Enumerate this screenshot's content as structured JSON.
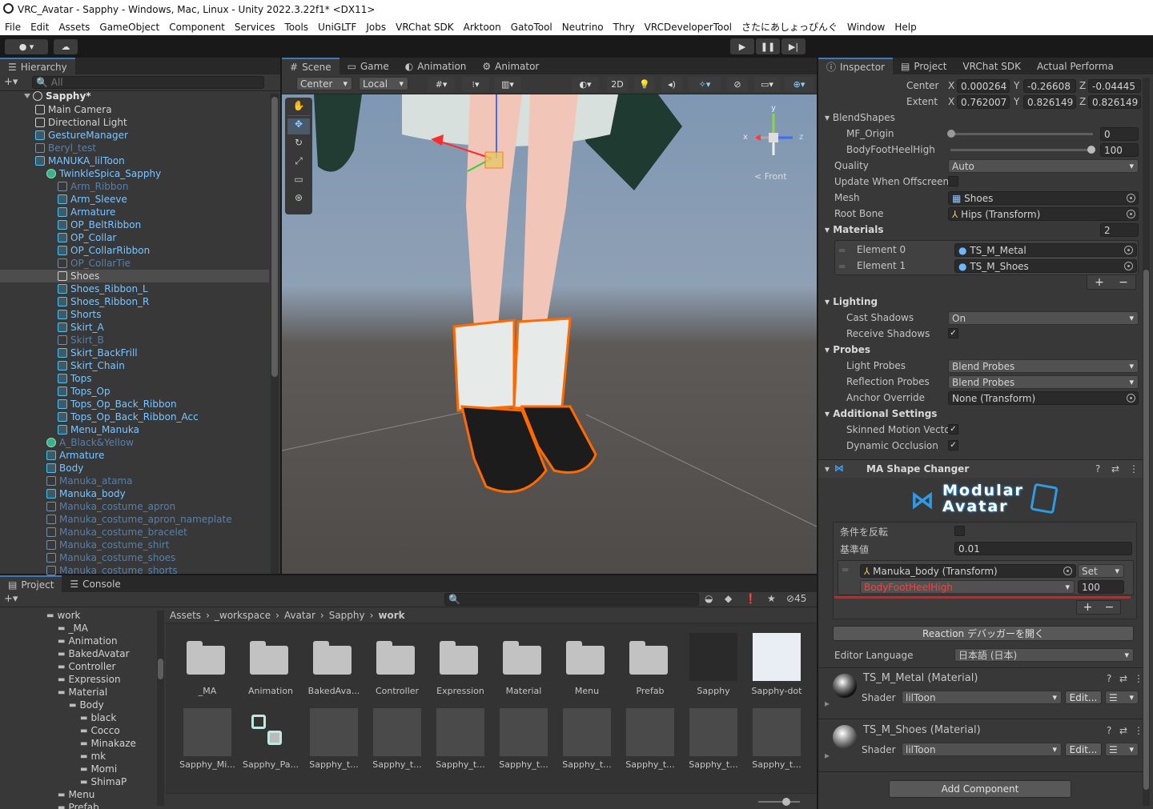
{
  "window_title": "VRC_Avatar - Sapphy - Windows, Mac, Linux - Unity 2022.3.22f1* <DX11>",
  "menu": [
    "File",
    "Edit",
    "Assets",
    "GameObject",
    "Component",
    "Services",
    "Tools",
    "UniGLTF",
    "Jobs",
    "VRChat SDK",
    "Arktoon",
    "GatoTool",
    "Neutrino",
    "Thry",
    "VRCDeveloperTool",
    "さたにあしょっぴんぐ",
    "Window",
    "Help"
  ],
  "hierarchy": {
    "tab": "Hierarchy",
    "search_placeholder": "All",
    "scene": "Sapphy*",
    "rows": [
      {
        "t": "Main Camera",
        "i": 1,
        "c": "n"
      },
      {
        "t": "Directional Light",
        "i": 1,
        "c": "n"
      },
      {
        "t": "GestureManager",
        "i": 1,
        "c": "b"
      },
      {
        "t": "Beryl_test",
        "i": 1,
        "c": "d"
      },
      {
        "t": "MANUKA_lilToon",
        "i": 1,
        "c": "b"
      },
      {
        "t": "TwinkleSpica_Sapphy",
        "i": 2,
        "c": "b"
      },
      {
        "t": "Arm_Ribbon",
        "i": 3,
        "c": "d"
      },
      {
        "t": "Arm_Sleeve",
        "i": 3,
        "c": "b"
      },
      {
        "t": "Armature",
        "i": 3,
        "c": "b"
      },
      {
        "t": "OP_BeltRibbon",
        "i": 3,
        "c": "b"
      },
      {
        "t": "OP_Collar",
        "i": 3,
        "c": "b"
      },
      {
        "t": "OP_CollarRibbon",
        "i": 3,
        "c": "b"
      },
      {
        "t": "OP_CollarTie",
        "i": 3,
        "c": "d"
      },
      {
        "t": "Shoes",
        "i": 3,
        "c": "n"
      },
      {
        "t": "Shoes_Ribbon_L",
        "i": 3,
        "c": "b"
      },
      {
        "t": "Shoes_Ribbon_R",
        "i": 3,
        "c": "b"
      },
      {
        "t": "Shorts",
        "i": 3,
        "c": "b"
      },
      {
        "t": "Skirt_A",
        "i": 3,
        "c": "b"
      },
      {
        "t": "Skirt_B",
        "i": 3,
        "c": "d"
      },
      {
        "t": "Skirt_BackFrill",
        "i": 3,
        "c": "b"
      },
      {
        "t": "Skirt_Chain",
        "i": 3,
        "c": "b"
      },
      {
        "t": "Tops",
        "i": 3,
        "c": "b"
      },
      {
        "t": "Tops_Op",
        "i": 3,
        "c": "b"
      },
      {
        "t": "Tops_Op_Back_Ribbon",
        "i": 3,
        "c": "b"
      },
      {
        "t": "Tops_Op_Back_Ribbon_Acc",
        "i": 3,
        "c": "b"
      },
      {
        "t": "Menu_Manuka",
        "i": 3,
        "c": "b"
      },
      {
        "t": "A_Black&Yellow",
        "i": 2,
        "c": "d"
      },
      {
        "t": "Armature",
        "i": 2,
        "c": "b"
      },
      {
        "t": "Body",
        "i": 2,
        "c": "b"
      },
      {
        "t": "Manuka_atama",
        "i": 2,
        "c": "d"
      },
      {
        "t": "Manuka_body",
        "i": 2,
        "c": "b"
      },
      {
        "t": "Manuka_costume_apron",
        "i": 2,
        "c": "d"
      },
      {
        "t": "Manuka_costume_apron_nameplate",
        "i": 2,
        "c": "d"
      },
      {
        "t": "Manuka_costume_bracelet",
        "i": 2,
        "c": "d"
      },
      {
        "t": "Manuka_costume_shirt",
        "i": 2,
        "c": "d"
      },
      {
        "t": "Manuka_costume_shoes",
        "i": 2,
        "c": "d"
      },
      {
        "t": "Manuka_costume_shorts",
        "i": 2,
        "c": "d"
      }
    ]
  },
  "scene_tabs": [
    "Scene",
    "Game",
    "Animation",
    "Animator"
  ],
  "scene_toolbar": {
    "pivot": "Center",
    "space": "Local",
    "mode2d": "2D"
  },
  "gizmo": {
    "front": "Front",
    "x": "x",
    "y": "y",
    "z": "z"
  },
  "inspector": {
    "tabs": [
      "Inspector",
      "Project",
      "VRChat SDK",
      "Actual Performa"
    ],
    "bounds": {
      "center_label": "Center",
      "center": [
        "0.000264",
        "-0.26608",
        "-0.04445"
      ],
      "extent_label": "Extent",
      "extent": [
        "0.762007",
        "0.826149",
        "0.826149"
      ],
      "x": "X",
      "y": "Y",
      "z": "Z"
    },
    "blendshapes": "BlendShapes",
    "mf_origin": {
      "label": "MF_Origin",
      "value": "0"
    },
    "bodyfootheel": {
      "label": "BodyFootHeelHigh",
      "value": "100"
    },
    "quality": {
      "label": "Quality",
      "value": "Auto"
    },
    "update_offscreen": "Update When Offscreen",
    "mesh": {
      "label": "Mesh",
      "value": "Shoes"
    },
    "root_bone": {
      "label": "Root Bone",
      "value": "Hips (Transform)"
    },
    "materials": {
      "label": "Materials",
      "count": "2",
      "el0_label": "Element 0",
      "el0": "TS_M_Metal",
      "el1_label": "Element 1",
      "el1": "TS_M_Shoes"
    },
    "lighting": "Lighting",
    "cast_shadows": {
      "label": "Cast Shadows",
      "value": "On"
    },
    "receive_shadows": "Receive Shadows",
    "probes": "Probes",
    "light_probes": {
      "label": "Light Probes",
      "value": "Blend Probes"
    },
    "reflection_probes": {
      "label": "Reflection Probes",
      "value": "Blend Probes"
    },
    "anchor_override": {
      "label": "Anchor Override",
      "value": "None (Transform)"
    },
    "additional": "Additional Settings",
    "skinned_motion": "Skinned Motion Vecto",
    "dynamic_occlusion": "Dynamic Occlusion",
    "ma_title": "MA Shape Changer",
    "ma_logo_1": "Modular",
    "ma_logo_2": "Avatar",
    "invert_label": "条件を反転",
    "threshold_label": "基準値",
    "threshold": "0.01",
    "target": "Manuka_body (Transform)",
    "set": "Set",
    "shape_name": "BodyFootHeelHigh",
    "shape_value": "100",
    "reaction_btn": "Reaction デバッガーを開く",
    "editor_lang_label": "Editor Language",
    "editor_lang": "日本語 (日本)",
    "mat1_title": "TS_M_Metal (Material)",
    "mat2_title": "TS_M_Shoes (Material)",
    "shader_label": "Shader",
    "shader": "lilToon",
    "edit": "Edit...",
    "add_component": "Add Component"
  },
  "project": {
    "tabs": [
      "Project",
      "Console"
    ],
    "count": "45",
    "tree": [
      {
        "t": "work",
        "d": 0
      },
      {
        "t": "_MA",
        "d": 1
      },
      {
        "t": "Animation",
        "d": 1
      },
      {
        "t": "BakedAvatar",
        "d": 1
      },
      {
        "t": "Controller",
        "d": 1
      },
      {
        "t": "Expression",
        "d": 1
      },
      {
        "t": "Material",
        "d": 1
      },
      {
        "t": "Body",
        "d": 2
      },
      {
        "t": "black",
        "d": 3
      },
      {
        "t": "Cocco",
        "d": 3
      },
      {
        "t": "Minakaze",
        "d": 3
      },
      {
        "t": "mk",
        "d": 3
      },
      {
        "t": "Momi",
        "d": 3
      },
      {
        "t": "ShimaP",
        "d": 3
      },
      {
        "t": "Menu",
        "d": 1
      },
      {
        "t": "Prefab",
        "d": 1
      }
    ],
    "breadcrumb": [
      "Assets",
      "_workspace",
      "Avatar",
      "Sapphy",
      "work"
    ],
    "row1": [
      "_MA",
      "Animation",
      "BakedAva...",
      "Controller",
      "Expression",
      "Material",
      "Menu",
      "Prefab",
      "Sapphy",
      "Sapphy-dot"
    ],
    "row2": [
      "Sapphy_Mi...",
      "Sapphy_Pa...",
      "Sapphy_t...",
      "Sapphy_t...",
      "Sapphy_t...",
      "Sapphy_t...",
      "Sapphy_t...",
      "Sapphy_t...",
      "Sapphy_t...",
      "Sapphy_t..."
    ]
  }
}
